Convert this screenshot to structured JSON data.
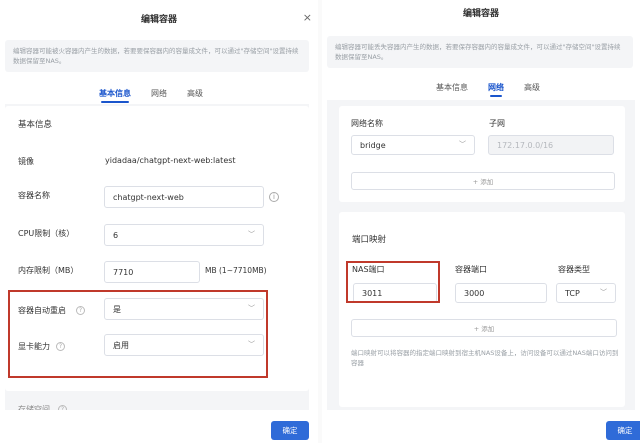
{
  "left": {
    "title": "编辑容器",
    "close_glyph": "×",
    "info_text": "编辑容器可能被火容器内产生的数据，若要要保容器内的容量成文件，可以通过\"存储空间\"设置持续数据保留至NAS。",
    "tabs": [
      {
        "label": "基本信息",
        "active": true
      },
      {
        "label": "网络",
        "active": false
      },
      {
        "label": "高级",
        "active": false
      }
    ],
    "section_title": "基本信息",
    "image": {
      "label": "镜像",
      "value": "yidadaa/chatgpt-next-web:latest"
    },
    "container_name": {
      "label": "容器名称",
      "value": "chatgpt-next-web",
      "info_glyph": "i"
    },
    "cpu": {
      "label": "CPU限制（核）",
      "value": "6"
    },
    "memory": {
      "label": "内存限制（MB）",
      "value": "7710",
      "unit": "MB (1~7710MB)"
    },
    "autostart": {
      "label": "容器自动重启",
      "value": "是",
      "help_glyph": "?"
    },
    "gpu": {
      "label": "显卡能力",
      "value": "启用",
      "help_glyph": "?"
    },
    "storage": {
      "label": "存储空间",
      "help_glyph": "?"
    },
    "ok_label": "确定"
  },
  "right": {
    "title": "编辑容器",
    "info_text": "编辑容器可能丢失容器内产生的数据，若要保存容器内的容量成文件，可以通过\"存储空间\"设置持续数据保留至NAS。",
    "tabs": [
      {
        "label": "基本信息",
        "active": false
      },
      {
        "label": "网络",
        "active": true
      },
      {
        "label": "高级",
        "active": false
      }
    ],
    "network": {
      "name_label": "网络名称",
      "subnet_label": "子网",
      "name_value": "bridge",
      "subnet_value": "172.17.0.0/16",
      "add_label": "+ 添加"
    },
    "ports": {
      "section_title": "端口映射",
      "nas_port_label": "NAS端口",
      "container_port_label": "容器端口",
      "type_label": "容器类型",
      "nas_port_value": "3011",
      "container_port_value": "3000",
      "type_value": "TCP",
      "add_label": "+ 添加",
      "note": "端口映射可以将容器的指定端口映射到宿主机NAS设备上，访问设备可以通过NAS端口访问到容器"
    },
    "ok_label": "确定"
  },
  "colors": {
    "accent": "#2f6bd8",
    "highlight": "#c0392b"
  }
}
